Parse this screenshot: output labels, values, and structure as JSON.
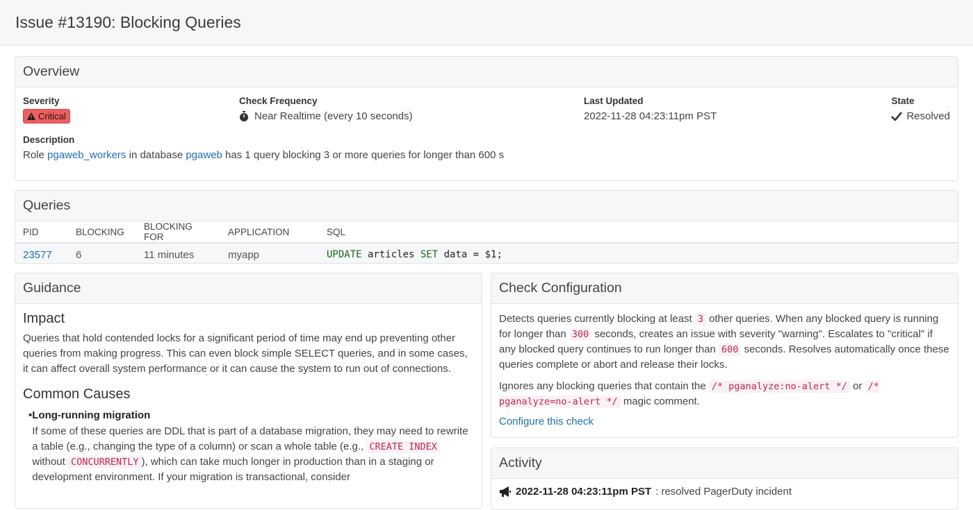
{
  "page": {
    "title": "Issue #13190: Blocking Queries"
  },
  "overview": {
    "heading": "Overview",
    "severity_label": "Severity",
    "severity_value": "Critical",
    "frequency_label": "Check Frequency",
    "frequency_value": "Near Realtime (every 10 seconds)",
    "updated_label": "Last Updated",
    "updated_value": "2022-11-28 04:23:11pm PST",
    "state_label": "State",
    "state_value": "Resolved",
    "description_label": "Description",
    "desc_1": "Role ",
    "desc_role": "pgaweb_workers",
    "desc_2": " in database ",
    "desc_db": "pgaweb",
    "desc_3": " has 1 query blocking 3 or more queries for longer than 600 s"
  },
  "queries": {
    "heading": "Queries",
    "columns": [
      "PID",
      "BLOCKING",
      "BLOCKING FOR",
      "APPLICATION",
      "SQL"
    ],
    "rows": [
      {
        "pid": "23577",
        "blocking": "6",
        "blocking_for": "11 minutes",
        "application": "myapp",
        "sql_1": "UPDATE",
        "sql_2": " articles ",
        "sql_3": "SET",
        "sql_4": " data = $1;"
      }
    ]
  },
  "guidance": {
    "heading": "Guidance",
    "impact_title": "Impact",
    "impact_text": "Queries that hold contended locks for a significant period of time may end up preventing other queries from making progress. This can even block simple SELECT queries, and in some cases, it can affect overall system performance or it can cause the system to run out of connections.",
    "causes_title": "Common Causes",
    "cause_1_title": "Long-running migration",
    "cause_1_a": "If some of these queries are DDL that is part of a database migration, they may need to rewrite a table (e.g., changing the type of a column) or scan a whole table (e.g., ",
    "cause_1_code1": "CREATE INDEX",
    "cause_1_b": " without ",
    "cause_1_code2": "CONCURRENTLY",
    "cause_1_c": "), which can take much longer in production than in a staging or development environment. If your migration is transactional, consider"
  },
  "config": {
    "heading": "Check Configuration",
    "p1_a": "Detects queries currently blocking at least ",
    "p1_v1": "3",
    "p1_b": " other queries. When any blocked query is running for longer than ",
    "p1_v2": "300",
    "p1_c": " seconds, creates an issue with severity \"warning\". Escalates to \"critical\" if any blocked query continues to run longer than ",
    "p1_v3": "600",
    "p1_d": " seconds. Resolves automatically once these queries complete or abort and release their locks.",
    "p2_a": "Ignores any blocking queries that contain the ",
    "p2_code1": "/* pganalyze:no-alert */",
    "p2_b": " or ",
    "p2_code2": "/* pganalyze=no-alert */",
    "p2_c": " magic comment.",
    "configure_link": "Configure this check"
  },
  "activity": {
    "heading": "Activity",
    "items": [
      {
        "timestamp": "2022-11-28 04:23:11pm PST",
        "text": ": resolved PagerDuty incident"
      }
    ]
  },
  "icons": {
    "severity": "warning-triangle-icon",
    "frequency": "stopwatch-icon",
    "state": "checkmark-icon",
    "activity": "megaphone-icon"
  },
  "colors": {
    "link": "#1d6fb5",
    "critical": "#e8605f",
    "code": "#c7254e"
  }
}
